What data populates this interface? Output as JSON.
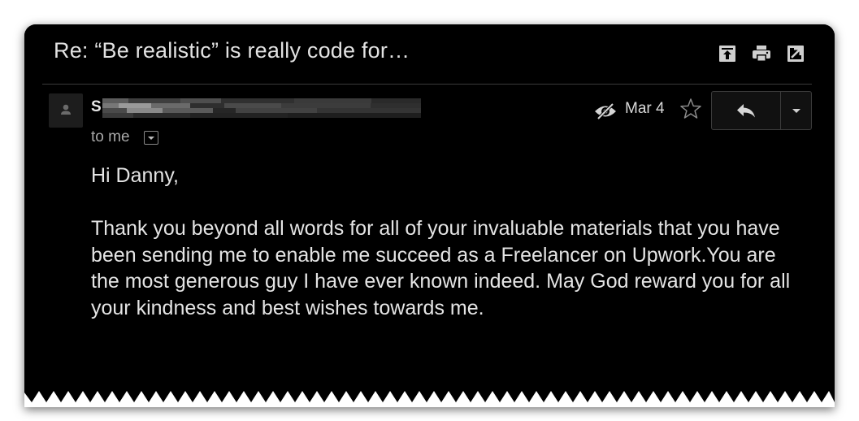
{
  "email": {
    "subject": "Re: “Be realistic” is really code for…",
    "sender_initial": "S",
    "recipient_label": "to me",
    "date": "Mar 4",
    "greeting": "Hi Danny,",
    "body": "Thank you beyond all words for all of your invaluable materials that you have been sending me to enable me succeed as a Freelancer on Upwork.You are the most generous guy I have ever known indeed. May God reward you for all your kindness and best wishes towards me."
  },
  "icons": {
    "archive": "archive-up-icon",
    "print": "printer-icon",
    "open_new_window": "open-in-new-window-icon",
    "avatar": "person-silhouette-icon",
    "tracking": "eye-slash-icon",
    "star": "star-outline-icon",
    "reply": "reply-arrow-icon",
    "more": "caret-down-icon"
  },
  "colors": {
    "background": "#000000",
    "text_primary": "#e4e4e4",
    "text_secondary": "#a9a9a9",
    "border": "#3b3b3b"
  }
}
